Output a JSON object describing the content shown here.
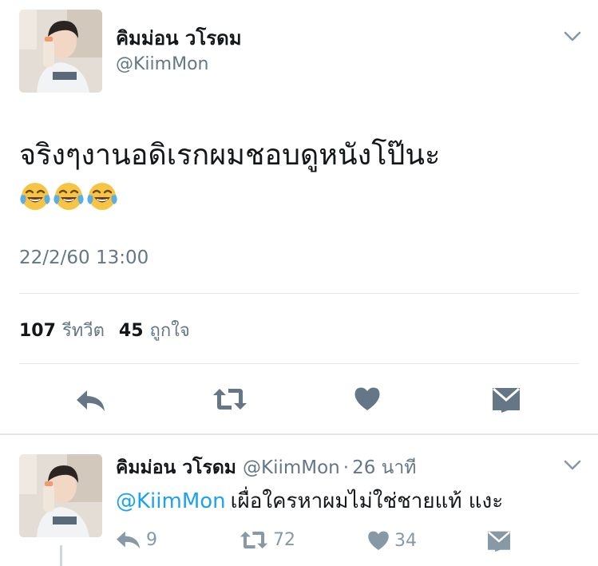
{
  "main_tweet": {
    "display_name": "คิมม่อน วโรดม",
    "handle": "@KiimMon",
    "text": "จริงๆงานอดิเรกผมชอบดูหนังโป๊นะ",
    "emoji": [
      "😂",
      "😂",
      "😂"
    ],
    "timestamp": "22/2/60 13:00",
    "retweet_count": "107",
    "retweet_label": "รีทวีต",
    "like_count": "45",
    "like_label": "ถูกใจ",
    "icons": [
      "reply-icon",
      "retweet-icon",
      "heart-icon",
      "envelope-icon",
      "chevron-down-icon"
    ]
  },
  "reply_tweet": {
    "display_name": "คิมม่อน วโรดม",
    "handle": "@KiimMon",
    "dot": "·",
    "time_ago": "26 นาที",
    "mention": "@KiimMon",
    "text": "เผื่อใครหาผมไม่ใช่ชายแท้ แงะ",
    "reply_count": "9",
    "retweet_count": "72",
    "like_count": "34"
  },
  "colors": {
    "text_primary": "#14171a",
    "text_secondary": "#657786",
    "icon_gray": "#657786",
    "icon_light": "#8899a6",
    "link_blue": "#1da1f2",
    "divider": "#e1e8ed"
  }
}
